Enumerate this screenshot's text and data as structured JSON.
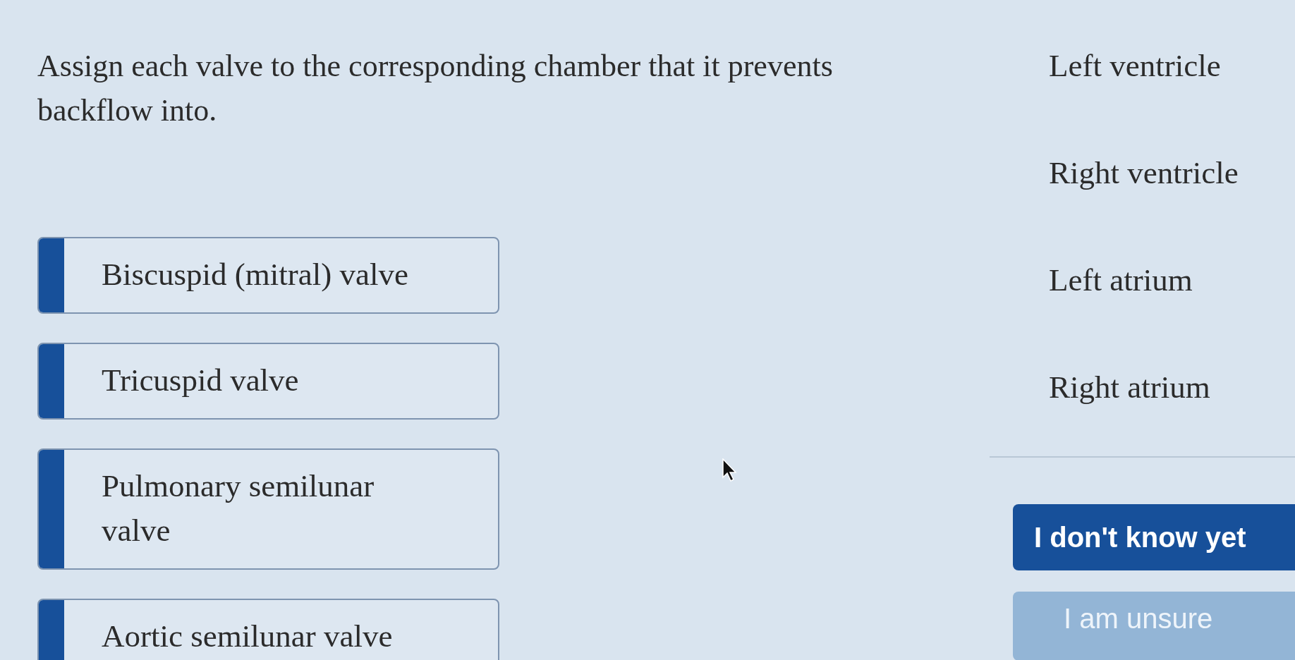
{
  "question": "Assign each valve to the corresponding chamber that it prevents backflow into.",
  "valves": [
    {
      "label": "Biscuspid (mitral) valve"
    },
    {
      "label": "Tricuspid valve"
    },
    {
      "label": "Pulmonary semilunar valve"
    },
    {
      "label": "Aortic semilunar valve"
    }
  ],
  "chambers": [
    {
      "label": "Left ventricle"
    },
    {
      "label": "Right ventricle"
    },
    {
      "label": "Left atrium"
    },
    {
      "label": "Right atrium"
    }
  ],
  "buttons": [
    {
      "label": "I don't know yet",
      "disabled": false
    },
    {
      "label": "I am unsure",
      "disabled": true
    }
  ]
}
